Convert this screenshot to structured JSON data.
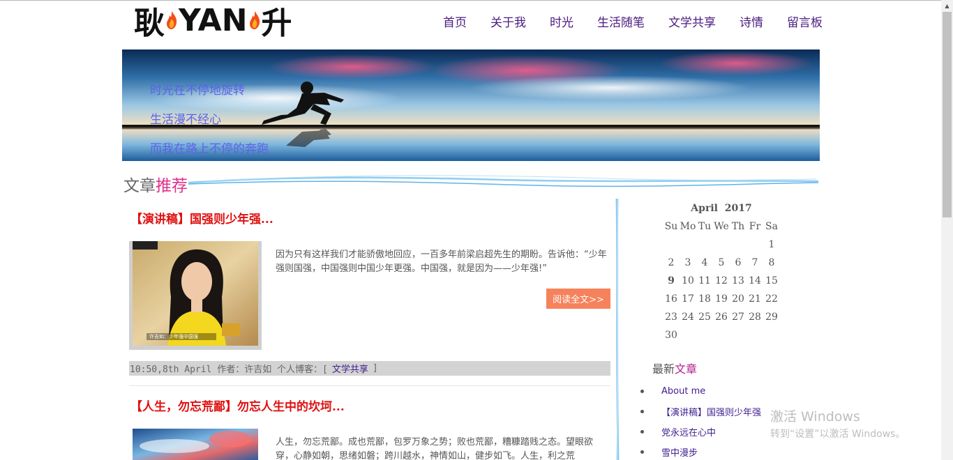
{
  "logo": {
    "text_left": "耿",
    "text_mid": "YAN",
    "text_right": "升"
  },
  "nav": {
    "items": [
      {
        "label": "首页"
      },
      {
        "label": "关于我"
      },
      {
        "label": "时光"
      },
      {
        "label": "生活随笔"
      },
      {
        "label": "文学共享"
      },
      {
        "label": "诗情"
      },
      {
        "label": "留言板"
      }
    ]
  },
  "banner": {
    "lines": [
      "时光在不停地旋转",
      "生活漫不经心",
      "而我在路上不停的奔跑"
    ]
  },
  "section": {
    "title_plain": "文章",
    "title_accent": "推荐"
  },
  "articles": [
    {
      "title": "【演讲稿】国强则少年强...",
      "excerpt": "因为只有这样我们才能骄傲地回应，一百多年前梁启超先生的期盼。告诉他：“少年强则国强，中国强则中国少年更强。中国强，就是因为——少年强!”",
      "read_more": "阅读全文>>",
      "meta_prefix": "10:50,8th April 作者：许吉如 个人博客：[",
      "category": "文学共享",
      "meta_suffix": "]",
      "thumb_caption": "许吉如：少年强中国强"
    },
    {
      "title": "【人生，勿忘荒鄙】勿忘人生中的坎坷...",
      "excerpt": "人生，勿忘荒鄙。成也荒鄙，包罗万象之势；败也荒鄙，糟糠踏贱之态。望眼欲穿，心静如朝，思绪如磐；跨川越水，神情如山，健步如飞。人生，利之荒"
    }
  ],
  "calendar": {
    "month": "April",
    "year": "2017",
    "weekdays": [
      "Su",
      "Mo",
      "Tu",
      "We",
      "Th",
      "Fr",
      "Sa"
    ],
    "weeks": [
      [
        "",
        "",
        "",
        "",
        "",
        "",
        "1"
      ],
      [
        "2",
        "3",
        "4",
        "5",
        "6",
        "7",
        "8"
      ],
      [
        "9",
        "10",
        "11",
        "12",
        "13",
        "14",
        "15"
      ],
      [
        "16",
        "17",
        "18",
        "19",
        "20",
        "21",
        "22"
      ],
      [
        "23",
        "24",
        "25",
        "26",
        "27",
        "28",
        "29"
      ],
      [
        "30",
        "",
        "",
        "",
        "",
        "",
        ""
      ]
    ],
    "today": "9"
  },
  "recent": {
    "title_plain": "最新",
    "title_accent": "文章",
    "items": [
      {
        "label": "About me"
      },
      {
        "label": "【演讲稿】国强则少年强"
      },
      {
        "label": "党永远在心中"
      },
      {
        "label": "雪中漫步"
      }
    ]
  },
  "watermark": {
    "line1": "激活 Windows",
    "line2": "转到“设置”以激活 Windows。"
  },
  "colors": {
    "nav_link": "#4b1b7f",
    "article_title": "#e01010",
    "accent_pink": "#e0308a",
    "read_btn": "#f6825c",
    "banner_text": "#5b63e8"
  }
}
